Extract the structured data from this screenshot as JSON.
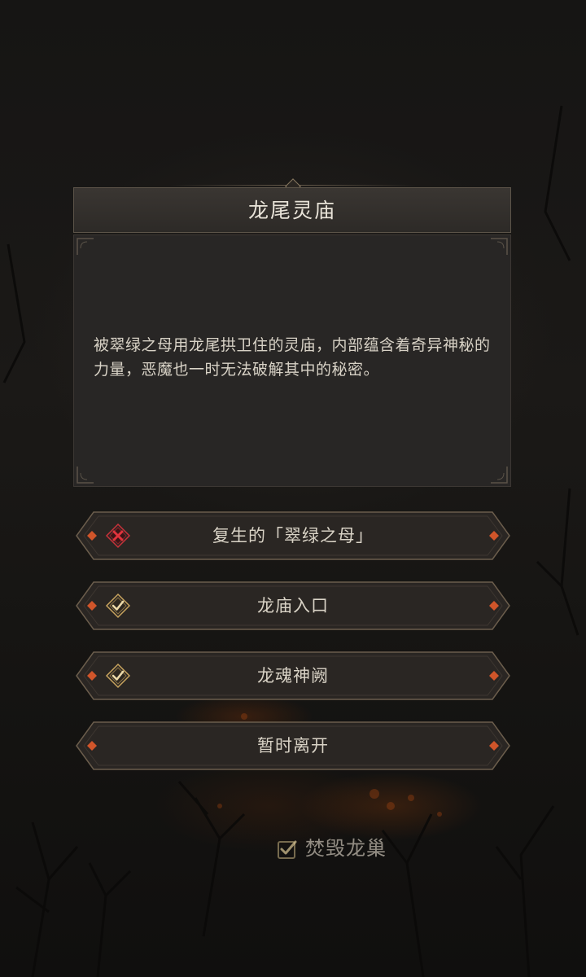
{
  "panel": {
    "title": "龙尾灵庙",
    "description": "被翠绿之母用龙尾拱卫住的灵庙，内部蕴含着奇异神秘的力量，恶魔也一时无法破解其中的秘密。"
  },
  "options": [
    {
      "label": "复生的「翠绿之母」",
      "icon": "locked-x-icon",
      "status": "failed"
    },
    {
      "label": "龙庙入口",
      "icon": "checkmark-icon",
      "status": "completed"
    },
    {
      "label": "龙魂神阙",
      "icon": "checkmark-icon",
      "status": "completed"
    },
    {
      "label": "暂时离开",
      "icon": "",
      "status": "none"
    }
  ],
  "hint": {
    "label": "焚毁龙巢",
    "icon": "checkbox-checked-icon"
  },
  "colors": {
    "accent_gold": "#c8a45e",
    "fail_red": "#c8313a",
    "gem_orange": "#d0552a",
    "frame": "#6b5d4c",
    "text": "#d9d3c6"
  }
}
